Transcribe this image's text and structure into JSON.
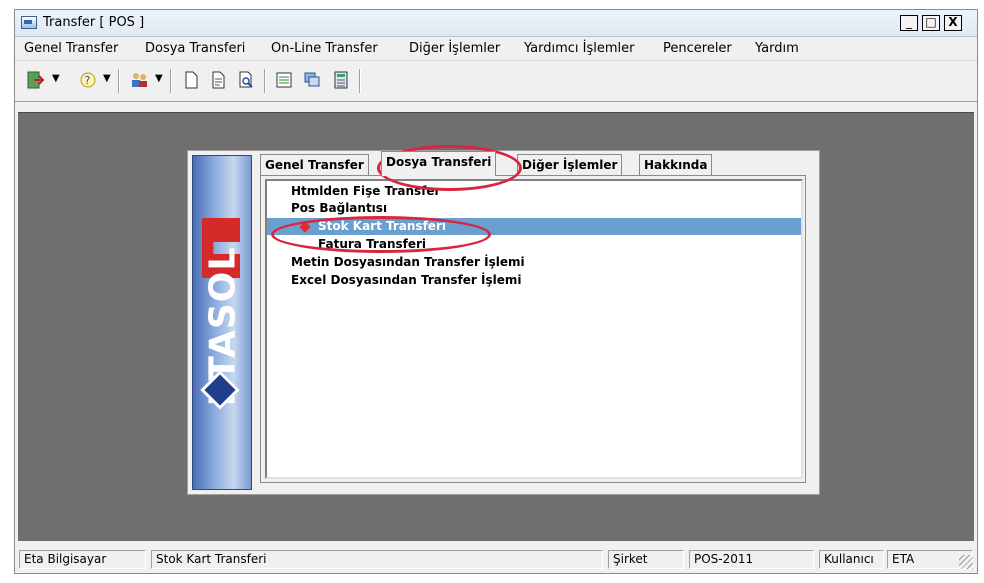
{
  "window": {
    "title": "Transfer [ POS ]",
    "controls": {
      "minimize": "_",
      "maximize": "□",
      "close": "X"
    }
  },
  "menu": [
    "Genel Transfer",
    "Dosya Transferi",
    "On-Line Transfer",
    "Diğer İşlemler",
    "Yardımcı İşlemler",
    "Pencereler",
    "Yardım"
  ],
  "toolbar": {
    "icons": [
      "exit-icon",
      "help-icon",
      "users-icon",
      "new-document-icon",
      "document-icon",
      "print-preview-icon",
      "list-icon",
      "windows-icon",
      "calculator-icon"
    ]
  },
  "panel": {
    "logo_text": "ETASOL",
    "tabs": [
      "Genel Transfer",
      "Dosya Transferi",
      "Diğer İşlemler",
      "Hakkında"
    ],
    "active_tab": "Dosya Transferi",
    "tree": {
      "items": [
        {
          "label": "Htmlden Fişe Transfer",
          "level": 0
        },
        {
          "label": "Pos Bağlantısı",
          "level": 0
        },
        {
          "label": "Stok Kart Transferi",
          "level": 1,
          "selected": true
        },
        {
          "label": "Fatura Transferi",
          "level": 1
        },
        {
          "label": "Metin Dosyasından Transfer İşlemi",
          "level": 0
        },
        {
          "label": "Excel Dosyasından Transfer İşlemi",
          "level": 0
        }
      ]
    }
  },
  "status": {
    "company": "Eta Bilgisayar",
    "current": "Stok Kart Transferi",
    "sirket_label": "Şirket",
    "sirket_value": "POS-2011",
    "user_label": "Kullanıcı",
    "user_value": "ETA"
  },
  "colors": {
    "selection": "#6b9fd0",
    "highlight_ring": "#d7263d",
    "workspace": "#6f6f6f"
  }
}
